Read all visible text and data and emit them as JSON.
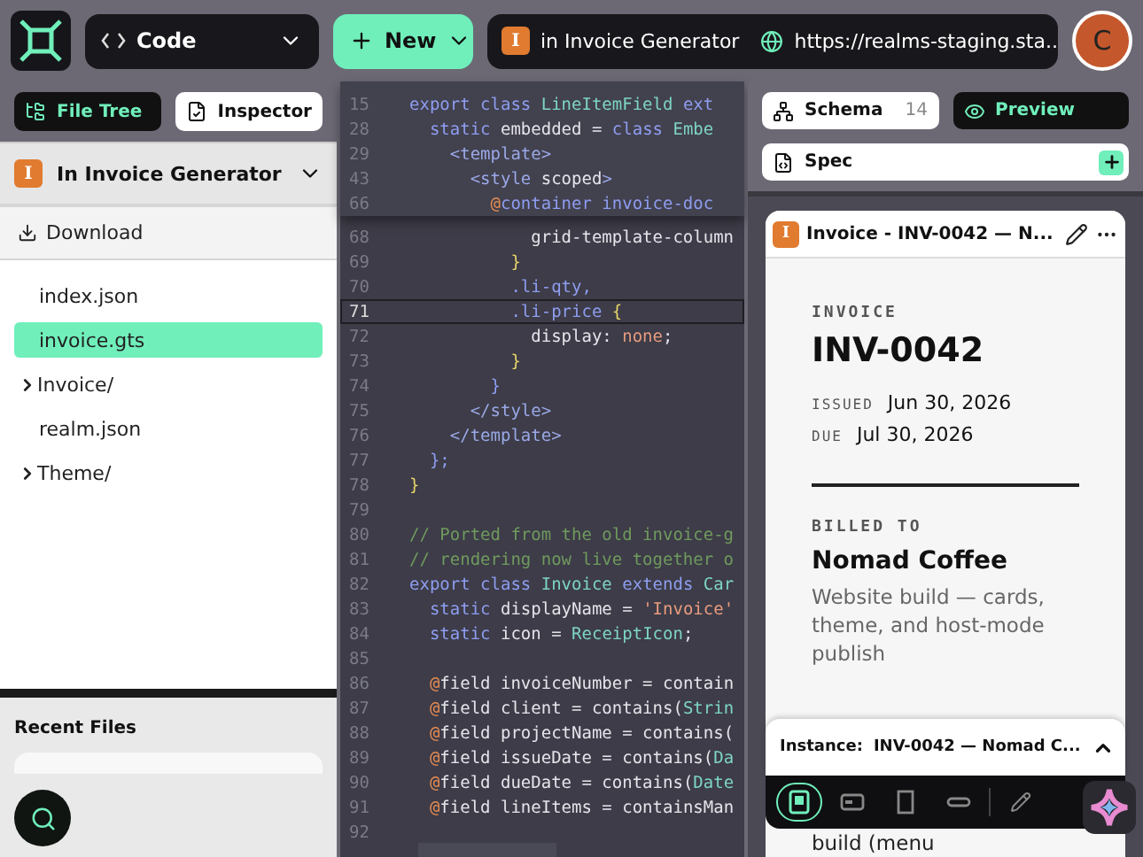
{
  "top_bar": {
    "mode": {
      "label": "Code"
    },
    "new_button": {
      "label": "New"
    },
    "realm": {
      "badge": "I",
      "name": "in Invoice Generator"
    },
    "url": "https://realms-staging.sta...",
    "avatar": "C"
  },
  "left_panel": {
    "tabs": [
      {
        "label": "File Tree",
        "selected": true
      },
      {
        "label": "Inspector",
        "selected": false
      }
    ],
    "realm": {
      "badge": "I",
      "name": "In Invoice Generator"
    },
    "download": "Download",
    "files": [
      {
        "name": "index.json",
        "kind": "file",
        "selected": false
      },
      {
        "name": "invoice.gts",
        "kind": "file",
        "selected": true
      },
      {
        "name": "Invoice/",
        "kind": "folder",
        "selected": false
      },
      {
        "name": "realm.json",
        "kind": "file",
        "selected": false
      },
      {
        "name": "Theme/",
        "kind": "folder",
        "selected": false
      }
    ],
    "recent_files": {
      "title": "Recent Files"
    }
  },
  "editor": {
    "sticky_lines": [
      {
        "number": "15",
        "tokens": [
          {
            "text": "export class ",
            "kind": "keyword"
          },
          {
            "text": "LineItemField ",
            "kind": "type"
          },
          {
            "text": "ext",
            "kind": "keyword"
          }
        ]
      },
      {
        "number": "28",
        "tokens": [
          {
            "text": "  static ",
            "kind": "keyword"
          },
          {
            "text": "embedded = ",
            "kind": "plain"
          },
          {
            "text": "class ",
            "kind": "keyword"
          },
          {
            "text": "Embe",
            "kind": "type"
          }
        ]
      },
      {
        "number": "29",
        "tokens": [
          {
            "text": "    <template>",
            "kind": "tag"
          }
        ]
      },
      {
        "number": "43",
        "tokens": [
          {
            "text": "      <style ",
            "kind": "tag"
          },
          {
            "text": "scoped",
            "kind": "plain"
          },
          {
            "text": ">",
            "kind": "tag"
          }
        ]
      },
      {
        "number": "66",
        "tokens": [
          {
            "text": "        @",
            "kind": "decorator"
          },
          {
            "text": "container invoice-doc",
            "kind": "keyword"
          }
        ]
      }
    ],
    "lines": [
      {
        "number": "68",
        "current": false,
        "tokens": [
          {
            "text": "            grid-template-column",
            "kind": "plain"
          }
        ]
      },
      {
        "number": "69",
        "current": false,
        "tokens": [
          {
            "text": "          }",
            "kind": "brace"
          }
        ]
      },
      {
        "number": "70",
        "current": false,
        "tokens": [
          {
            "text": "          .li-qty,",
            "kind": "keyword"
          }
        ]
      },
      {
        "number": "71",
        "current": true,
        "tokens": [
          {
            "text": "          .li-price ",
            "kind": "keyword"
          },
          {
            "text": "{",
            "kind": "brace"
          }
        ]
      },
      {
        "number": "72",
        "current": false,
        "tokens": [
          {
            "text": "            display: ",
            "kind": "plain"
          },
          {
            "text": "none",
            "kind": "string"
          },
          {
            "text": ";",
            "kind": "plain"
          }
        ]
      },
      {
        "number": "73",
        "current": false,
        "tokens": [
          {
            "text": "          }",
            "kind": "brace"
          }
        ]
      },
      {
        "number": "74",
        "current": false,
        "tokens": [
          {
            "text": "        }",
            "kind": "keyword"
          }
        ]
      },
      {
        "number": "75",
        "current": false,
        "tokens": [
          {
            "text": "      </style>",
            "kind": "tag"
          }
        ]
      },
      {
        "number": "76",
        "current": false,
        "tokens": [
          {
            "text": "    </template>",
            "kind": "tag"
          }
        ]
      },
      {
        "number": "77",
        "current": false,
        "tokens": [
          {
            "text": "  };",
            "kind": "keyword"
          }
        ]
      },
      {
        "number": "78",
        "current": false,
        "tokens": [
          {
            "text": "}",
            "kind": "brace"
          }
        ]
      },
      {
        "number": "79",
        "current": false
      },
      {
        "number": "80",
        "current": false,
        "tokens": [
          {
            "text": "// Ported from the old invoice-g",
            "kind": "comment"
          }
        ]
      },
      {
        "number": "81",
        "current": false,
        "tokens": [
          {
            "text": "// rendering now live together o",
            "kind": "comment"
          }
        ]
      },
      {
        "number": "82",
        "current": false,
        "tokens": [
          {
            "text": "export class ",
            "kind": "keyword"
          },
          {
            "text": "Invoice ",
            "kind": "type"
          },
          {
            "text": "extends ",
            "kind": "keyword"
          },
          {
            "text": "Car",
            "kind": "type"
          }
        ]
      },
      {
        "number": "83",
        "current": false,
        "tokens": [
          {
            "text": "  static ",
            "kind": "keyword"
          },
          {
            "text": "displayName = ",
            "kind": "plain"
          },
          {
            "text": "'Invoice'",
            "kind": "string"
          }
        ]
      },
      {
        "number": "84",
        "current": false,
        "tokens": [
          {
            "text": "  static ",
            "kind": "keyword"
          },
          {
            "text": "icon = ",
            "kind": "plain"
          },
          {
            "text": "ReceiptIcon",
            "kind": "type"
          },
          {
            "text": ";",
            "kind": "plain"
          }
        ]
      },
      {
        "number": "85",
        "current": false
      },
      {
        "number": "86",
        "current": false,
        "tokens": [
          {
            "text": "  @",
            "kind": "decorator"
          },
          {
            "text": "field invoiceNumber = contain",
            "kind": "plain"
          }
        ]
      },
      {
        "number": "87",
        "current": false,
        "tokens": [
          {
            "text": "  @",
            "kind": "decorator"
          },
          {
            "text": "field client = contains(",
            "kind": "plain"
          },
          {
            "text": "Strin",
            "kind": "type"
          }
        ]
      },
      {
        "number": "88",
        "current": false,
        "tokens": [
          {
            "text": "  @",
            "kind": "decorator"
          },
          {
            "text": "field projectName = contains(",
            "kind": "plain"
          }
        ]
      },
      {
        "number": "89",
        "current": false,
        "tokens": [
          {
            "text": "  @",
            "kind": "decorator"
          },
          {
            "text": "field issueDate = contains(",
            "kind": "plain"
          },
          {
            "text": "Da",
            "kind": "type"
          }
        ]
      },
      {
        "number": "90",
        "current": false,
        "tokens": [
          {
            "text": "  @",
            "kind": "decorator"
          },
          {
            "text": "field dueDate = contains(",
            "kind": "plain"
          },
          {
            "text": "Date",
            "kind": "type"
          }
        ]
      },
      {
        "number": "91",
        "current": false,
        "tokens": [
          {
            "text": "  @",
            "kind": "decorator"
          },
          {
            "text": "field lineItems = containsMan",
            "kind": "plain"
          }
        ]
      },
      {
        "number": "92",
        "current": false
      }
    ]
  },
  "right_panel": {
    "tabs": [
      {
        "label": "Schema",
        "count": "14",
        "selected": false
      },
      {
        "label": "Preview",
        "selected": true
      }
    ],
    "spec": {
      "label": "Spec"
    },
    "card": {
      "badge": "I",
      "title": "Invoice - INV-0042 — N...",
      "eyebrow": "INVOICE",
      "number": "INV-0042",
      "dates": [
        {
          "label": "ISSUED",
          "value": "Jun 30, 2026"
        },
        {
          "label": "DUE",
          "value": "Jul 30, 2026"
        }
      ],
      "billed_label": "BILLED TO",
      "client": "Nomad Coffee",
      "description": "Website build — cards, theme, and host-mode publish",
      "next_line": "build (menu"
    },
    "instance": {
      "label": "Instance:",
      "value": "INV-0042 — Nomad C..."
    },
    "format_tools": [
      {
        "kind": "isolated",
        "selected": true
      },
      {
        "kind": "embedded",
        "selected": false
      },
      {
        "kind": "fitted",
        "selected": false
      },
      {
        "kind": "atom",
        "selected": false
      },
      {
        "kind": "edit",
        "selected": false
      }
    ]
  }
}
